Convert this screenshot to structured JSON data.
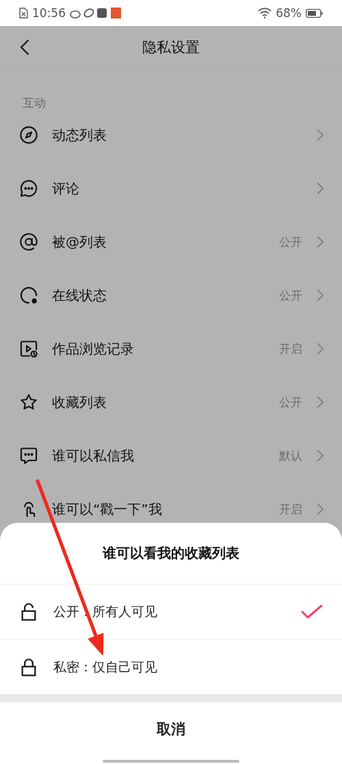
{
  "status_bar": {
    "time": "10:56",
    "battery": "68%"
  },
  "header": {
    "title": "隐私设置"
  },
  "section": {
    "title": "互动"
  },
  "rows": [
    {
      "label": "动态列表"
    },
    {
      "label": "评论"
    },
    {
      "label": "被@列表",
      "value": "公开"
    },
    {
      "label": "在线状态",
      "value": "公开"
    },
    {
      "label": "作品浏览记录",
      "value": "开启"
    },
    {
      "label": "收藏列表",
      "value": "公开"
    },
    {
      "label": "谁可以私信我",
      "value": "默认"
    },
    {
      "label": "谁可以“戳一下”我",
      "value": "开启"
    }
  ],
  "sheet": {
    "title": "谁可以看我的收藏列表",
    "options": [
      {
        "label": "公开：所有人可见",
        "selected": true
      },
      {
        "label": "私密：仅自己可见",
        "selected": false
      }
    ],
    "cancel": "取消"
  }
}
